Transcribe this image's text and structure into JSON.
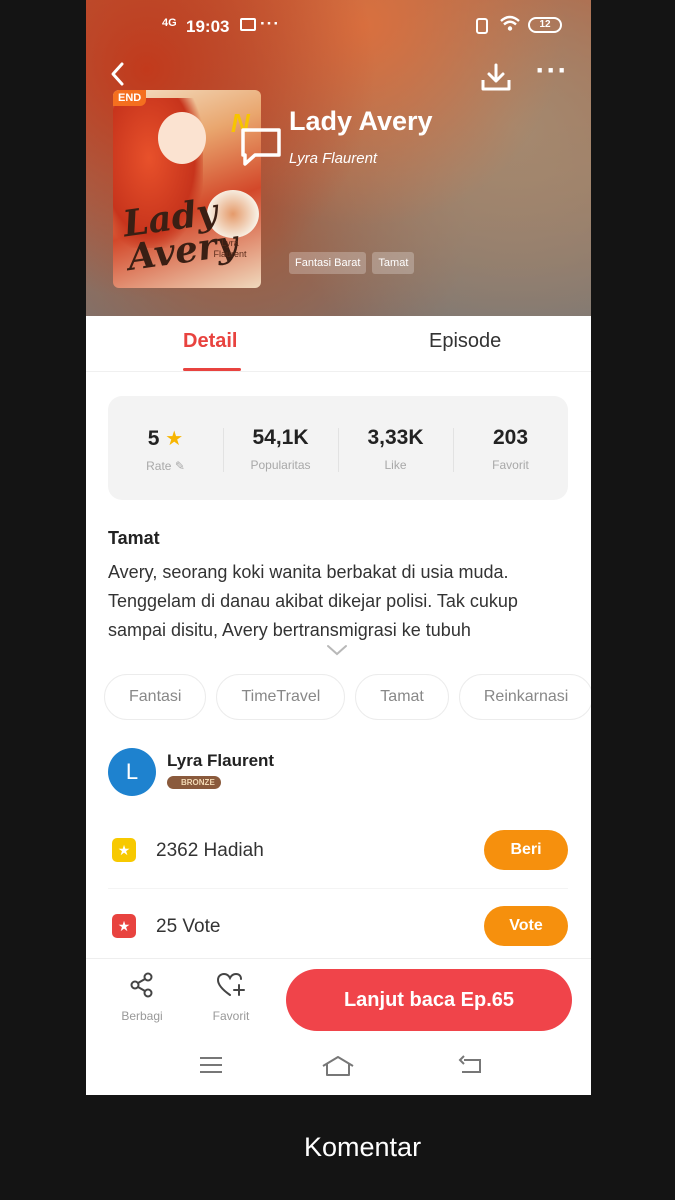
{
  "status_bar": {
    "signal": "4G",
    "time": "19:03",
    "more": "···",
    "battery": "12"
  },
  "header": {
    "back_icon": "chevron-left-icon",
    "download_icon": "download-icon",
    "more_label": "···"
  },
  "book": {
    "title": "Lady Avery",
    "author": "Lyra Flaurent",
    "cover": {
      "badge": "END",
      "art_title": "Lady Avery",
      "art_author": "Lyra Flaurent",
      "art_mark": "N"
    },
    "genre_tags": [
      "Fantasi Barat",
      "Tamat"
    ]
  },
  "tabs": [
    {
      "label": "Detail",
      "active": true
    },
    {
      "label": "Episode",
      "active": false
    }
  ],
  "stats": [
    {
      "value": "5",
      "label": "Rate",
      "icon": "star-icon"
    },
    {
      "value": "54,1K",
      "label": "Popularitas"
    },
    {
      "value": "3,33K",
      "label": "Like"
    },
    {
      "value": "203",
      "label": "Favorit"
    }
  ],
  "description": {
    "status": "Tamat",
    "text": "Avery, seorang koki wanita berbakat di usia muda. Tenggelam di danau akibat dikejar polisi. Tak cukup sampai disitu, Avery bertransmigrasi ke tubuh"
  },
  "topics": [
    "Fantasi",
    "TimeTravel",
    "Tamat",
    "Reinkarnasi"
  ],
  "author_card": {
    "initial": "L",
    "name": "Lyra Flaurent",
    "badge": "BRONZE"
  },
  "gift": {
    "count_text": "2362 Hadiah",
    "button": "Beri"
  },
  "vote": {
    "count_text": "25 Vote",
    "button": "Vote"
  },
  "action_bar": {
    "share_label": "Berbagi",
    "favorite_label": "Favorit",
    "continue_label": "Lanjut baca Ep.65"
  },
  "comment": {
    "label": "Komentar"
  },
  "colors": {
    "accent": "#e8433f",
    "orange": "#f6900d",
    "gold": "#f7b500",
    "avatar": "#1e82cf"
  }
}
